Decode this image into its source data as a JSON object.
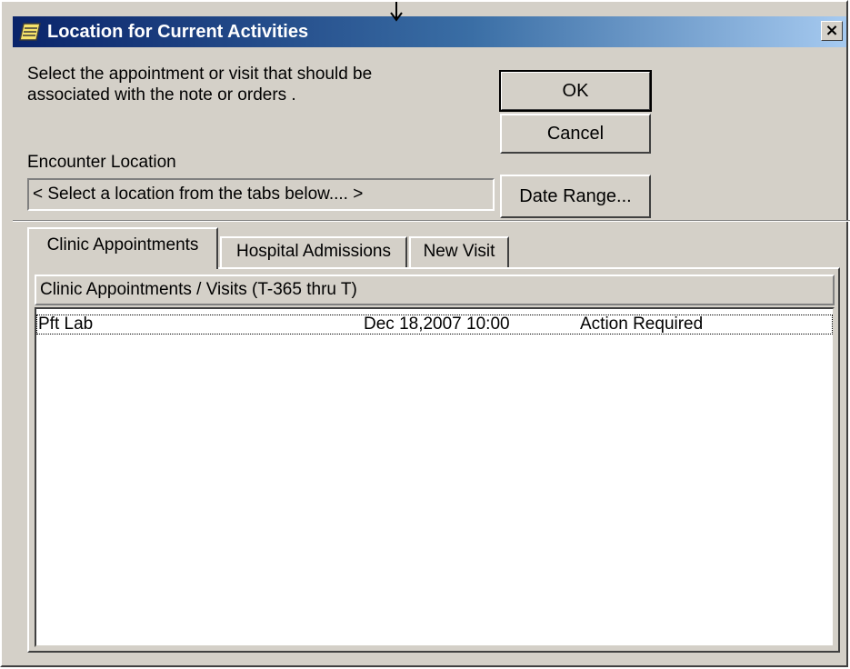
{
  "window": {
    "title": "Location for Current Activities",
    "close_label": "×",
    "title_icon": "notepad-icon",
    "colors": {
      "titlebar_start": "#0a246a",
      "titlebar_end": "#a6caf0",
      "face": "#d4d0c8"
    }
  },
  "instruction": "Select the appointment or visit that should be associated with the note or orders .",
  "buttons": {
    "ok": "OK",
    "cancel": "Cancel",
    "date_range": "Date Range..."
  },
  "encounter": {
    "label": "Encounter Location",
    "value": "< Select a location from the tabs below.... >"
  },
  "tabs": [
    {
      "label": "Clinic Appointments",
      "active": true
    },
    {
      "label": "Hospital Admissions",
      "active": false
    },
    {
      "label": "New Visit",
      "active": false
    }
  ],
  "list": {
    "header": "Clinic Appointments / Visits  (T-365 thru T)",
    "rows": [
      {
        "location": "Pft Lab",
        "date": "Dec 18,2007 10:00",
        "status": "Action Required"
      }
    ]
  }
}
